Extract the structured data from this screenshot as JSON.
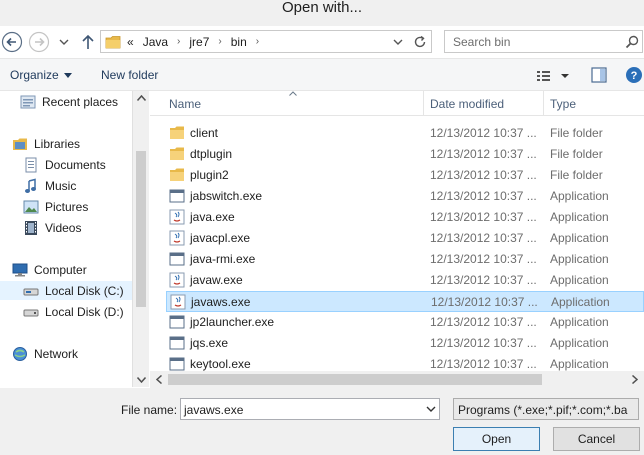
{
  "window": {
    "title": "Open with..."
  },
  "address": {
    "crumbs": [
      "«",
      "Java",
      "jre7",
      "bin"
    ],
    "search_placeholder": "Search bin"
  },
  "toolbar": {
    "organize": "Organize",
    "new_folder": "New folder"
  },
  "nav": {
    "items": [
      {
        "label": "Recent places",
        "icon": "recent-places-icon"
      },
      {
        "label": "Libraries",
        "icon": "libraries-icon"
      },
      {
        "label": "Documents",
        "icon": "documents-icon"
      },
      {
        "label": "Music",
        "icon": "music-icon"
      },
      {
        "label": "Pictures",
        "icon": "pictures-icon"
      },
      {
        "label": "Videos",
        "icon": "videos-icon"
      },
      {
        "label": "Computer",
        "icon": "computer-icon"
      },
      {
        "label": "Local Disk (C:)",
        "icon": "local-disk-icon"
      },
      {
        "label": "Local Disk (D:)",
        "icon": "local-disk-icon"
      },
      {
        "label": "Network",
        "icon": "network-icon"
      }
    ]
  },
  "columns": {
    "name": "Name",
    "date": "Date modified",
    "type": "Type"
  },
  "files": [
    {
      "name": "client",
      "date": "12/13/2012 10:37 ...",
      "type": "File folder",
      "icon": "folder-icon"
    },
    {
      "name": "dtplugin",
      "date": "12/13/2012 10:37 ...",
      "type": "File folder",
      "icon": "folder-icon"
    },
    {
      "name": "plugin2",
      "date": "12/13/2012 10:37 ...",
      "type": "File folder",
      "icon": "folder-icon"
    },
    {
      "name": "jabswitch.exe",
      "date": "12/13/2012 10:37 ...",
      "type": "Application",
      "icon": "application-icon"
    },
    {
      "name": "java.exe",
      "date": "12/13/2012 10:37 ...",
      "type": "Application",
      "icon": "java-icon"
    },
    {
      "name": "javacpl.exe",
      "date": "12/13/2012 10:37 ...",
      "type": "Application",
      "icon": "java-icon"
    },
    {
      "name": "java-rmi.exe",
      "date": "12/13/2012 10:37 ...",
      "type": "Application",
      "icon": "application-icon"
    },
    {
      "name": "javaw.exe",
      "date": "12/13/2012 10:37 ...",
      "type": "Application",
      "icon": "java-icon"
    },
    {
      "name": "javaws.exe",
      "date": "12/13/2012 10:37 ...",
      "type": "Application",
      "icon": "java-icon",
      "selected": true
    },
    {
      "name": "jp2launcher.exe",
      "date": "12/13/2012 10:37 ...",
      "type": "Application",
      "icon": "application-icon"
    },
    {
      "name": "jqs.exe",
      "date": "12/13/2012 10:37 ...",
      "type": "Application",
      "icon": "application-icon"
    },
    {
      "name": "keytool.exe",
      "date": "12/13/2012 10:37 ...",
      "type": "Application",
      "icon": "application-icon"
    }
  ],
  "bottom": {
    "file_name_label": "File name:",
    "file_name_value": "javaws.exe",
    "filter_value": "Programs (*.exe;*.pif;*.com;*.ba",
    "open_label": "Open",
    "cancel_label": "Cancel"
  },
  "colors": {
    "selection": "#cce8ff",
    "selection_border": "#99d1ff",
    "link": "#1e395b"
  }
}
